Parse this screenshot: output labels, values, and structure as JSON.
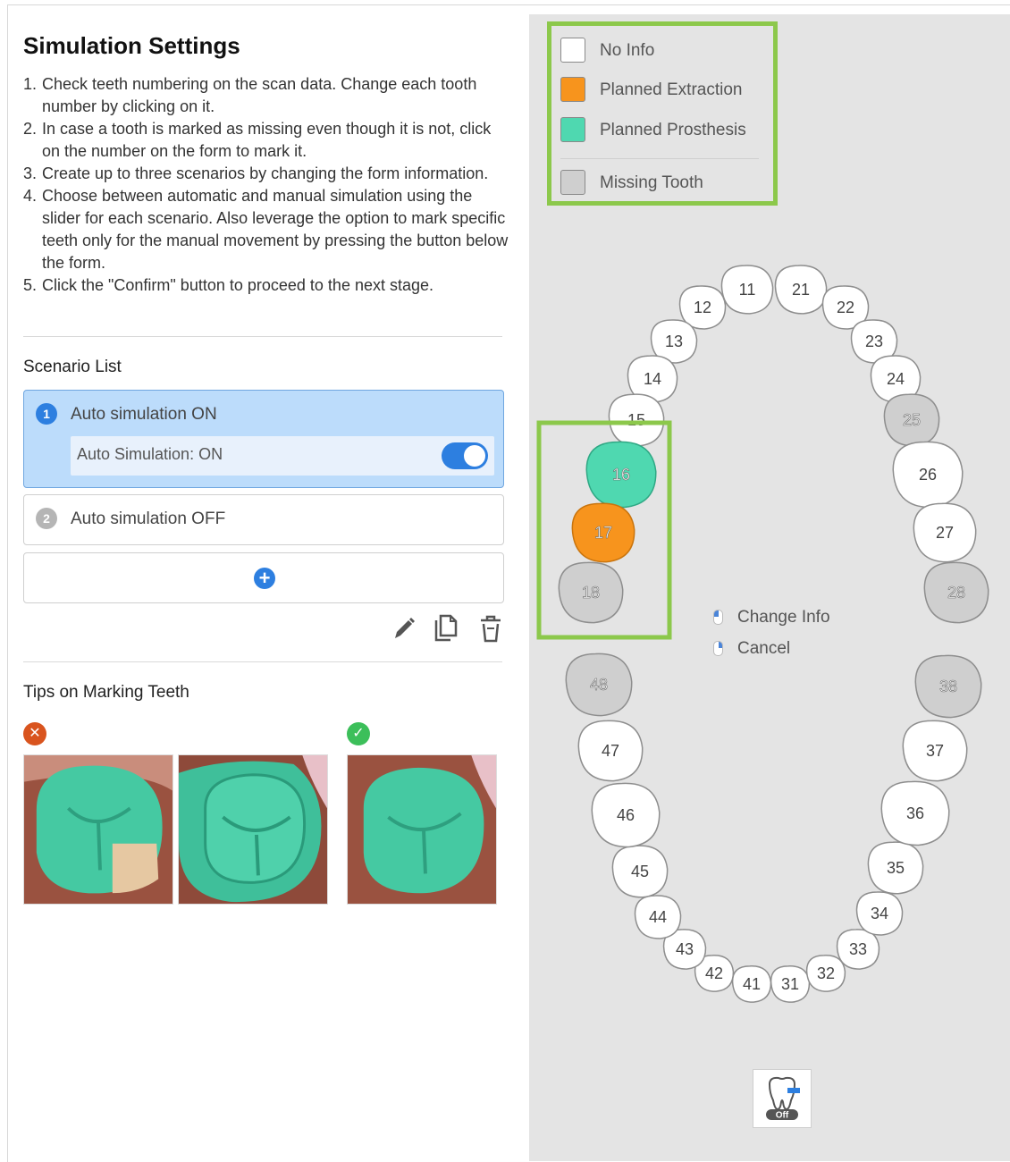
{
  "panel": {
    "title": "Simulation Settings",
    "instructions": [
      {
        "num": "1.",
        "text": "Check teeth numbering on the scan data. Change each tooth number by clicking on it."
      },
      {
        "num": "2.",
        "text": "In case a tooth is marked as missing even though it is not, click on the number on the form to mark it."
      },
      {
        "num": "3.",
        "text": "Create up to three scenarios by changing the form information."
      },
      {
        "num": "4.",
        "text": "Choose between automatic and manual simulation using the slider for each scenario. Also leverage the option to mark specific teeth only for the manual movement by pressing the button below the form."
      },
      {
        "num": "5.",
        "text": "Click the \"Confirm\" button to proceed to the next stage."
      }
    ]
  },
  "scenario_list": {
    "title": "Scenario List",
    "scenarios": [
      {
        "number": "1",
        "label": "Auto simulation ON",
        "toggle_label": "Auto Simulation: ON",
        "toggle_on": true,
        "selected": true,
        "badge_color": "#2d7fe0"
      },
      {
        "number": "2",
        "label": "Auto simulation OFF",
        "selected": false,
        "badge_color": "#b5b5b5"
      }
    ],
    "add_icon": "+",
    "tools": [
      "edit-icon",
      "copy-icon",
      "trash-icon"
    ]
  },
  "tips": {
    "title": "Tips on Marking Teeth",
    "wrong_symbol": "✕",
    "right_symbol": "✓",
    "wrong_color": "#d9541e",
    "right_color": "#3cbf5a"
  },
  "legend": {
    "items": [
      {
        "label": "No Info",
        "color": "#ffffff"
      },
      {
        "label": "Planned Extraction",
        "color": "#f7941d"
      },
      {
        "label": "Planned Prosthesis",
        "color": "#4fd8b0"
      },
      {
        "label": "Missing Tooth",
        "color": "#cfcfcf"
      }
    ]
  },
  "hints": {
    "change_info": "Change Info",
    "cancel": "Cancel"
  },
  "colors": {
    "accent": "#2d7fe0",
    "highlight_border": "#8cc84b",
    "extraction": "#f7941d",
    "prosthesis": "#4fd8b0",
    "missing": "#cfcfcf",
    "no_info": "#ffffff"
  },
  "teeth": [
    {
      "n": "11",
      "state": "none"
    },
    {
      "n": "12",
      "state": "none"
    },
    {
      "n": "13",
      "state": "none"
    },
    {
      "n": "14",
      "state": "none"
    },
    {
      "n": "15",
      "state": "none"
    },
    {
      "n": "16",
      "state": "prosthesis"
    },
    {
      "n": "17",
      "state": "extraction"
    },
    {
      "n": "18",
      "state": "missing"
    },
    {
      "n": "21",
      "state": "none"
    },
    {
      "n": "22",
      "state": "none"
    },
    {
      "n": "23",
      "state": "none"
    },
    {
      "n": "24",
      "state": "none"
    },
    {
      "n": "25",
      "state": "missing"
    },
    {
      "n": "26",
      "state": "none"
    },
    {
      "n": "27",
      "state": "none"
    },
    {
      "n": "28",
      "state": "missing"
    },
    {
      "n": "31",
      "state": "none"
    },
    {
      "n": "32",
      "state": "none"
    },
    {
      "n": "33",
      "state": "none"
    },
    {
      "n": "34",
      "state": "none"
    },
    {
      "n": "35",
      "state": "none"
    },
    {
      "n": "36",
      "state": "none"
    },
    {
      "n": "37",
      "state": "none"
    },
    {
      "n": "38",
      "state": "missing"
    },
    {
      "n": "41",
      "state": "none"
    },
    {
      "n": "42",
      "state": "none"
    },
    {
      "n": "43",
      "state": "none"
    },
    {
      "n": "44",
      "state": "none"
    },
    {
      "n": "45",
      "state": "none"
    },
    {
      "n": "46",
      "state": "none"
    },
    {
      "n": "47",
      "state": "none"
    },
    {
      "n": "48",
      "state": "missing"
    }
  ],
  "off_button": {
    "label": "Off"
  }
}
